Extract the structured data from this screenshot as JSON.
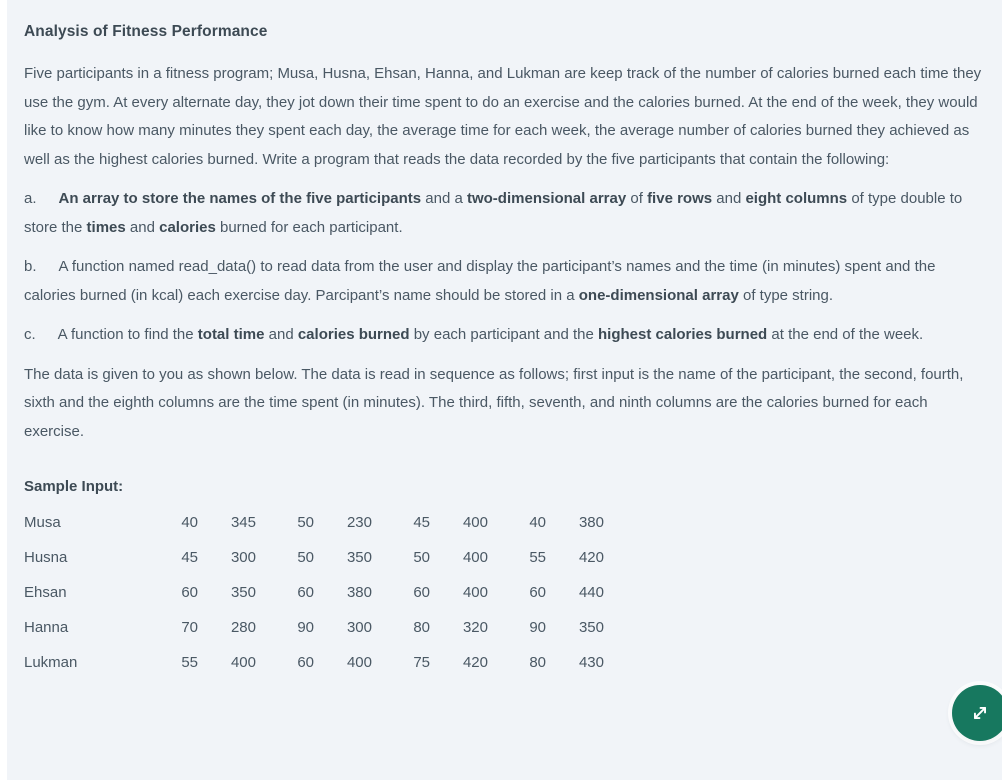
{
  "question": {
    "title": "Analysis of Fitness Performance",
    "intro": "Five participants in a fitness program; Musa, Husna, Ehsan, Hanna, and Lukman are keep track of the number of calories burned each time they use the gym. At every alternate day, they jot down their time spent to do an exercise and the calories burned. At the end of the week, they would like to know how many minutes they spent each day, the average time for each week, the average number of calories burned they achieved as well as the highest calories burned. Write a program that reads the data recorded by the five participants that contain the following:",
    "items": [
      {
        "marker": "a.",
        "parts": [
          {
            "text": "An array to store the names of the five participants",
            "bold": true
          },
          {
            "text": " and a ",
            "bold": false
          },
          {
            "text": "two-dimensional array",
            "bold": true
          },
          {
            "text": " of ",
            "bold": false
          },
          {
            "text": "five rows",
            "bold": true
          },
          {
            "text": " and ",
            "bold": false
          },
          {
            "text": "eight columns",
            "bold": true
          },
          {
            "text": " of type double to store the ",
            "bold": false
          },
          {
            "text": "times",
            "bold": true
          },
          {
            "text": " and ",
            "bold": false
          },
          {
            "text": "calories",
            "bold": true
          },
          {
            "text": " burned for each participant.",
            "bold": false
          }
        ]
      },
      {
        "marker": "b.",
        "parts": [
          {
            "text": "A function named read_data() to read data from the user and display the participant’s names and the time (in minutes) spent and the calories burned (in kcal) each exercise day. Parcipant’s name should be stored in a ",
            "bold": false
          },
          {
            "text": "one-dimensional array",
            "bold": true
          },
          {
            "text": " of type string.",
            "bold": false
          }
        ]
      },
      {
        "marker": "c.",
        "parts": [
          {
            "text": "A function to find the ",
            "bold": false
          },
          {
            "text": "total time",
            "bold": true
          },
          {
            "text": " and ",
            "bold": false
          },
          {
            "text": "calories burned",
            "bold": true
          },
          {
            "text": " by each participant and the ",
            "bold": false
          },
          {
            "text": "highest calories burned",
            "bold": true
          },
          {
            "text": " at the end of the week.",
            "bold": false
          }
        ]
      }
    ],
    "data_description": "The data is given to you as shown below. The data is read in sequence as follows; first input is the name of the participant, the second, fourth, sixth and the eighth columns are the time spent (in minutes). The third, fifth, seventh, and ninth columns are the calories burned for each exercise.",
    "sample_input_label": "Sample Input:",
    "sample_data": [
      {
        "name": "Musa",
        "values": [
          "40",
          "345",
          "50",
          "230",
          "45",
          "400",
          "40",
          "380"
        ]
      },
      {
        "name": "Husna",
        "values": [
          "45",
          "300",
          "50",
          "350",
          "50",
          "400",
          "55",
          "420"
        ]
      },
      {
        "name": "Ehsan",
        "values": [
          "60",
          "350",
          "60",
          "380",
          "60",
          "400",
          "60",
          "440"
        ]
      },
      {
        "name": "Hanna",
        "values": [
          "70",
          "280",
          "90",
          "300",
          "80",
          "320",
          "90",
          "350"
        ]
      },
      {
        "name": "Lukman",
        "values": [
          "55",
          "400",
          "60",
          "400",
          "75",
          "420",
          "80",
          "430"
        ]
      }
    ]
  },
  "fab": {
    "icon": "expand-arrows-icon",
    "color": "#17785f"
  },
  "theme": {
    "card_background": "#f1f4f8",
    "page_background": "#ffffff",
    "heading_color": "#3d4a54",
    "body_color": "#4a5864"
  }
}
